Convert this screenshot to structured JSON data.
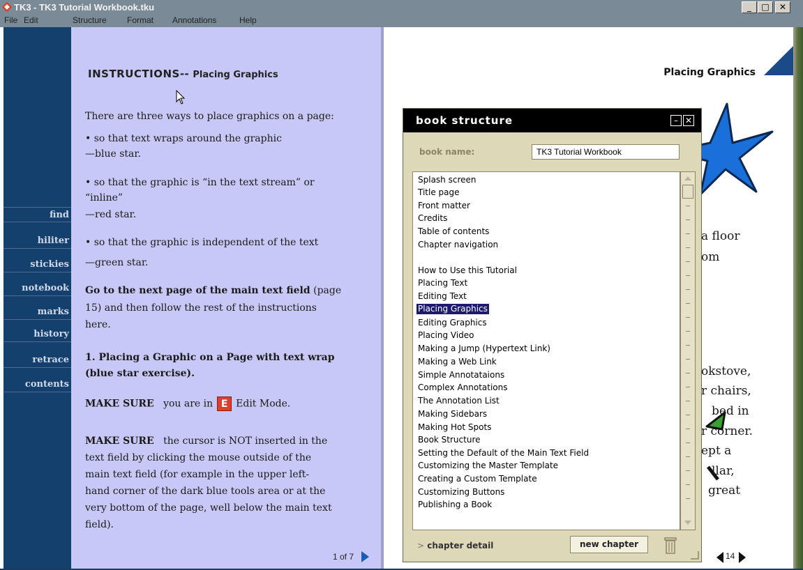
{
  "window": {
    "title": "TK3 - TK3 Tutorial Workbook.tku",
    "minimize": "_",
    "maximize": "□",
    "close": "✕"
  },
  "menu": [
    "File",
    "Edit",
    "Structure",
    "Format",
    "Annotations",
    "Help"
  ],
  "tools": [
    "find",
    "hiliter",
    "stickies",
    "notebook",
    "marks",
    "history",
    "retrace",
    "contents"
  ],
  "left_page": {
    "heading": "INSTRUCTIONS--",
    "subheading": "Placing Graphics",
    "lines": {
      "l1": "There are three ways to place graphics on a page:",
      "l2": "• so that text wraps around the graphic",
      "l3": "—blue star.",
      "l4": "• so that the graphic is “in the text stream” or",
      "l5": "“inline”",
      "l6": "—red star.",
      "l7": "• so that the graphic is independent of the text",
      "l8": "—green star.",
      "l9a": "Go to the next page of the main text field",
      "l9b": " (page",
      "l10": "15) and then follow the rest of the instructions",
      "l11": "here.",
      "l12": "1. Placing a Graphic on a Page with text wrap",
      "l13": "(blue star exercise).",
      "l14a": "MAKE SURE",
      "l14b": "you are in",
      "l14c": "Edit Mode.",
      "e_icon": "E",
      "l15a": "MAKE SURE",
      "l15b": "the cursor is NOT inserted in the",
      "l16": "text field by clicking the mouse outside of the",
      "l17": "main text field (for example in the upper left-",
      "l18": "hand corner of the dark blue tools area or at the",
      "l19": "very bottom of the page, well below the main text",
      "l20": "field)."
    },
    "pager": "1 of 7"
  },
  "right_page": {
    "title": "Placing Graphics",
    "fragments": [
      "a floor",
      "om",
      "okstove,",
      "r chairs,",
      "bed in",
      "r corner.",
      "ept a",
      "llar,",
      "great"
    ],
    "page_number": "14"
  },
  "dialog": {
    "title": "book structure",
    "book_name_label": "book name:",
    "book_name_value": "TK3 Tutorial Workbook",
    "chapters": [
      "Splash screen",
      "Title page",
      "Front matter",
      "Credits",
      "Table of contents",
      "Chapter navigation",
      "",
      "How to Use this Tutorial",
      "Placing Text",
      "Editing Text",
      "Placing Graphics",
      "Editing Graphics",
      "Placing Video",
      "Making a Jump (Hypertext Link)",
      "Making a Web Link",
      "Simple Annotataions",
      "Complex Annotations",
      "The Annotation List",
      "Making Sidebars",
      "Making Hot Spots",
      "Book Structure",
      "Setting the Default of the Main Text Field",
      "Customizing the Master Template",
      "Creating a Custom Template",
      "Customizing Buttons",
      "Publishing a Book"
    ],
    "selected_chapter": "Placing Graphics",
    "chapter_detail": "chapter detail",
    "new_chapter": "new chapter"
  },
  "colors": {
    "tools_bg": "#14406e",
    "page_bg": "#c8c8f8",
    "selection": "#1e1a6e",
    "star_blue": "#1a6fd8",
    "star_green": "#3aa032"
  }
}
